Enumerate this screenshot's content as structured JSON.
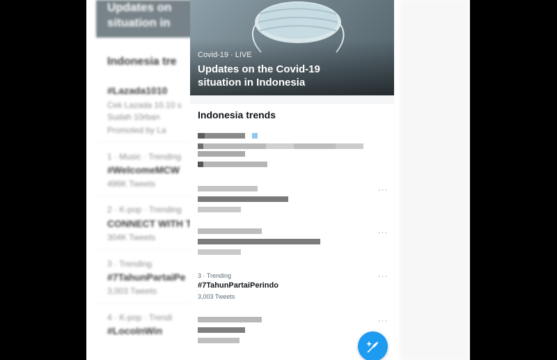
{
  "background": {
    "banner_title": "Updates on situation in",
    "heading": "Indonesia tre",
    "items": [
      {
        "name": "#Lazada1010",
        "desc_1": "Cek Lazada 10.10 s",
        "desc_2": "Sudah 10rban",
        "promo": "Promoted by La"
      },
      {
        "meta": "1 · Music · Trending",
        "name": "#WelcomeMCW",
        "count": "496K Tweets"
      },
      {
        "meta": "2 · K-pop · Trending",
        "name": "CONNECT WITH T",
        "count": "304K Tweets"
      },
      {
        "meta": "3 · Trending",
        "name": "#7TahunPartaiPe",
        "count": "3,003 Tweets"
      },
      {
        "meta": "4 · K-pop · Trendi",
        "name": "#LocoInWin",
        "count": ""
      }
    ]
  },
  "hero": {
    "kicker": "Covid-19 · LIVE",
    "title": "Updates on the Covid-19 situation in Indonesia"
  },
  "trends": {
    "heading": "Indonesia trends",
    "visible_item": {
      "meta": "3 · Trending",
      "name": "#7TahunPartaiPerindo",
      "count": "3,003 Tweets",
      "more": "···"
    },
    "more": "···"
  },
  "fab": {
    "icon": "compose-tweet-icon"
  },
  "colors": {
    "accent": "#1d9bf0",
    "text": "#0f1419",
    "muted": "#5b6b76"
  }
}
